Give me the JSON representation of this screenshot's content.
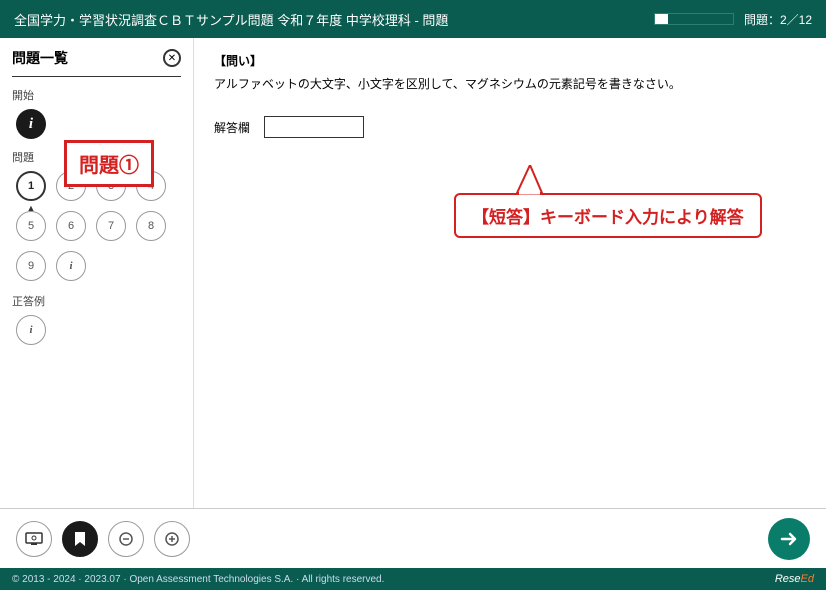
{
  "header": {
    "title": "全国学力・学習状況調査ＣＢＴサンプル問題 令和７年度 中学校理科 - 問題",
    "progress_label": "問題：2／12"
  },
  "sidebar": {
    "title": "問題一覧",
    "sections": {
      "start": "開始",
      "questions": "問題",
      "answers": "正答例"
    },
    "q_numbers": [
      "1",
      "2",
      "3",
      "4",
      "5",
      "6",
      "7",
      "8",
      "9"
    ],
    "annotation": "問題①"
  },
  "content": {
    "heading": "【問い】",
    "text": "アルファベットの大文字、小文字を区別して、マグネシウムの元素記号を書きなさい。",
    "answer_label": "解答欄",
    "answer_value": "",
    "callout": "【短答】キーボード入力により解答"
  },
  "footer": {
    "copyright": "© 2013 - 2024 · 2023.07 · Open Assessment Technologies S.A. · All rights reserved.",
    "brand_main": "Rese",
    "brand_accent": "Ed"
  }
}
